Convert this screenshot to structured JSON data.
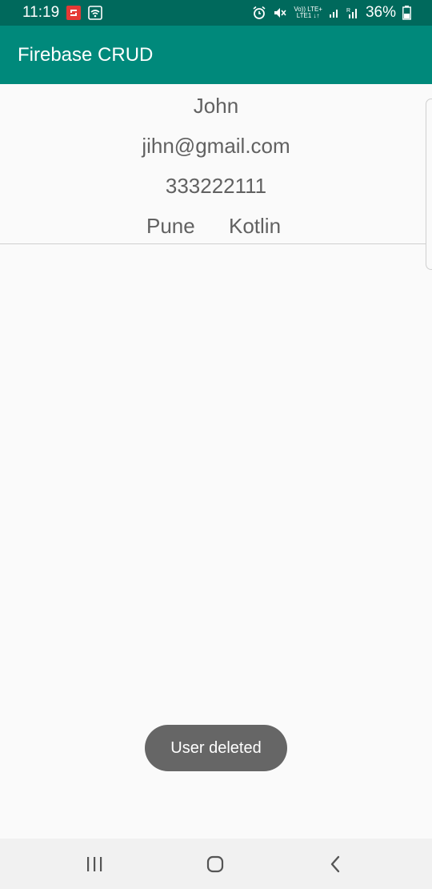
{
  "status_bar": {
    "time": "11:19",
    "net_top": "Vo)) LTE+",
    "net_bottom": "LTE1 ↓↑",
    "battery": "36%",
    "icons": [
      "notification-app-icon",
      "wifi-icon",
      "alarm-icon",
      "mute-icon",
      "signal-icon",
      "signal-roaming-icon",
      "battery-icon"
    ]
  },
  "app_bar": {
    "title": "Firebase CRUD"
  },
  "users": [
    {
      "name": "John",
      "email": "jihn@gmail.com",
      "phone": "333222111",
      "city": "Pune",
      "course": "Kotlin"
    }
  ],
  "toast": {
    "message": "User deleted"
  },
  "navigation": {
    "icons": [
      "recent-apps-icon",
      "home-icon",
      "back-icon"
    ]
  },
  "colors": {
    "status_bar": "#00695c",
    "app_bar": "#00897b",
    "text_secondary": "#616161",
    "toast_bg": "#666666"
  }
}
